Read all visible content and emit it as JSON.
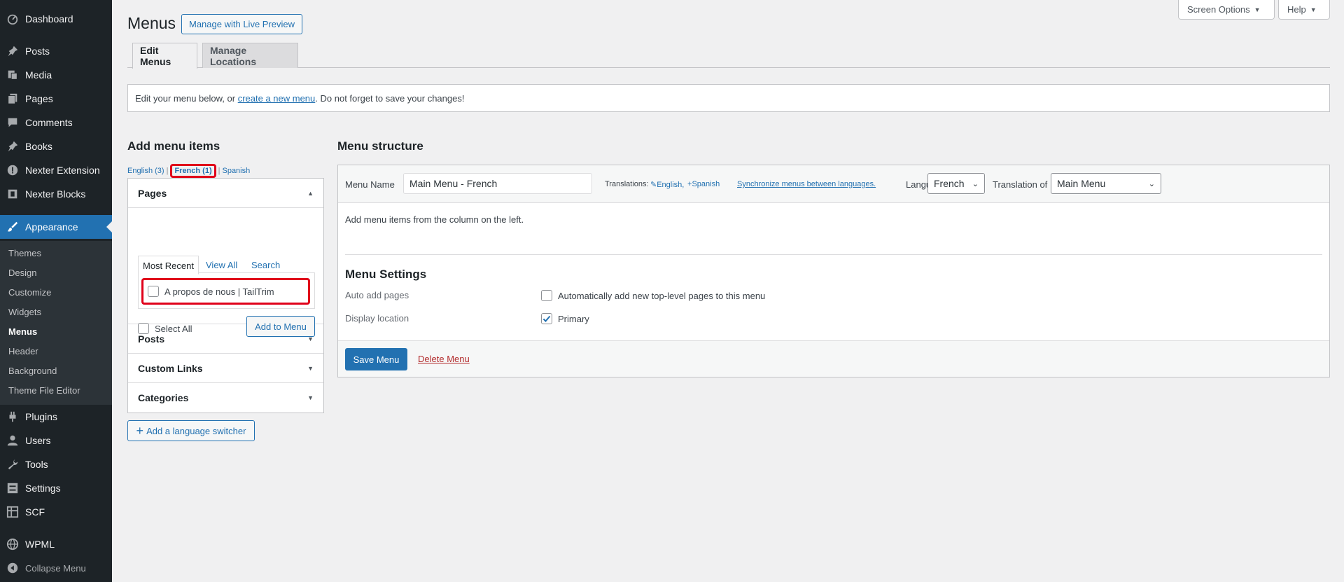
{
  "sidebar": {
    "items": [
      {
        "label": "Dashboard",
        "icon": "dashboard-icon"
      },
      {
        "label": "Posts",
        "icon": "pin-icon"
      },
      {
        "label": "Media",
        "icon": "media-icon"
      },
      {
        "label": "Pages",
        "icon": "pages-icon"
      },
      {
        "label": "Comments",
        "icon": "comment-icon"
      },
      {
        "label": "Books",
        "icon": "pin-icon"
      },
      {
        "label": "Nexter Extension",
        "icon": "info-icon"
      },
      {
        "label": "Nexter Blocks",
        "icon": "blocks-icon"
      },
      {
        "label": "Appearance",
        "icon": "brush-icon"
      },
      {
        "label": "Plugins",
        "icon": "plugin-icon"
      },
      {
        "label": "Users",
        "icon": "user-icon"
      },
      {
        "label": "Tools",
        "icon": "wrench-icon"
      },
      {
        "label": "Settings",
        "icon": "settings-icon"
      },
      {
        "label": "SCF",
        "icon": "grid-icon"
      },
      {
        "label": "WPML",
        "icon": "globe-icon"
      },
      {
        "label": "Collapse Menu",
        "icon": "collapse-icon"
      }
    ],
    "submenu": [
      "Themes",
      "Design",
      "Customize",
      "Widgets",
      "Menus",
      "Header",
      "Background",
      "Theme File Editor"
    ]
  },
  "top_buttons": {
    "screen_options": "Screen Options",
    "help": "Help"
  },
  "header": {
    "title": "Menus",
    "live_preview": "Manage with Live Preview"
  },
  "tabs": {
    "edit": "Edit Menus",
    "locations": "Manage Locations"
  },
  "notice": {
    "before": "Edit your menu below, or ",
    "link": "create a new menu",
    "after": ". Do not forget to save your changes!"
  },
  "add_items": {
    "title": "Add menu items",
    "languages": {
      "english": "English (3)",
      "french": "French (1)",
      "spanish": "Spanish",
      "separator": "|"
    },
    "pages": {
      "title": "Pages",
      "tabs": {
        "recent": "Most Recent",
        "all": "View All",
        "search": "Search"
      },
      "item": "A propos de nous | TailTrim",
      "select_all": "Select All",
      "add_button": "Add to Menu"
    },
    "posts": "Posts",
    "custom_links": "Custom Links",
    "categories": "Categories",
    "language_switcher": "Add a language switcher"
  },
  "menu_structure": {
    "title": "Menu structure",
    "menu_name_label": "Menu Name",
    "menu_name_value": "Main Menu - French",
    "translations_label": "Translations:",
    "translation_english": "English,",
    "translation_spanish": "Spanish",
    "sync_link": "Synchronize menus between languages.",
    "language_label": "Language",
    "language_value": "French",
    "translation_of_label": "Translation of",
    "translation_of_value": "Main Menu",
    "instructions": "Add menu items from the column on the left.",
    "settings_title": "Menu Settings",
    "auto_add_label": "Auto add pages",
    "auto_add_option": "Automatically add new top-level pages to this menu",
    "display_location_label": "Display location",
    "primary_option": "Primary",
    "save_button": "Save Menu",
    "delete_link": "Delete Menu"
  }
}
